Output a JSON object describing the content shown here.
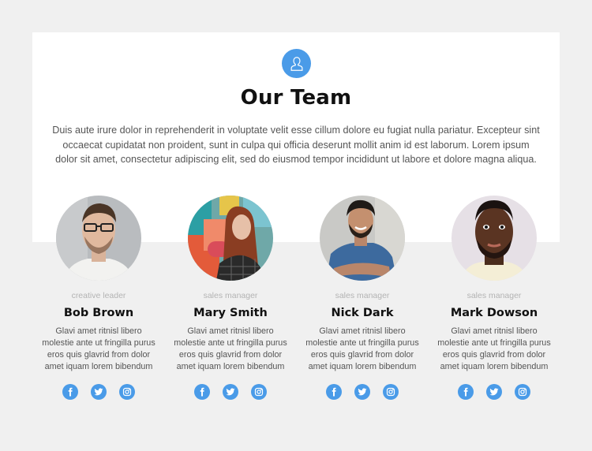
{
  "header": {
    "icon": "user-icon",
    "title": "Our Team",
    "intro": "Duis aute irure dolor in reprehenderit in voluptate velit esse cillum dolore eu fugiat nulla pariatur. Excepteur sint occaecat cupidatat non proident, sunt in culpa qui officia deserunt mollit anim id est laborum. Lorem ipsum dolor sit amet, consectetur adipiscing elit, sed do eiusmod tempor incididunt ut labore et dolore magna aliqua."
  },
  "colors": {
    "accent": "#4a9be8",
    "background": "#f0f0f0",
    "panel": "#ffffff",
    "role_text": "#b3b3b3",
    "body_text": "#555555"
  },
  "members": [
    {
      "role": "creative leader",
      "name": "Bob Brown",
      "bio": "Glavi amet ritnisl libero molestie ante ut fringilla purus eros quis glavrid from dolor amet iquam lorem bibendum",
      "photo": "man-with-glasses-photo",
      "socials": [
        "facebook-icon",
        "twitter-icon",
        "instagram-icon"
      ]
    },
    {
      "role": "sales manager",
      "name": "Mary Smith",
      "bio": "Glavi amet ritnisl libero molestie ante ut fringilla purus eros quis glavrid from dolor amet iquam lorem bibendum",
      "photo": "woman-graffiti-photo",
      "socials": [
        "facebook-icon",
        "twitter-icon",
        "instagram-icon"
      ]
    },
    {
      "role": "sales manager",
      "name": "Nick Dark",
      "bio": "Glavi amet ritnisl libero molestie ante ut fringilla purus eros quis glavrid from dolor amet iquam lorem bibendum",
      "photo": "smiling-man-blue-shirt-photo",
      "socials": [
        "facebook-icon",
        "twitter-icon",
        "instagram-icon"
      ]
    },
    {
      "role": "sales manager",
      "name": "Mark Dowson",
      "bio": "Glavi amet ritnisl libero molestie ante ut fringilla purus eros quis glavrid from dolor amet iquam lorem bibendum",
      "photo": "man-beard-photo",
      "socials": [
        "facebook-icon",
        "twitter-icon",
        "instagram-icon"
      ]
    }
  ]
}
